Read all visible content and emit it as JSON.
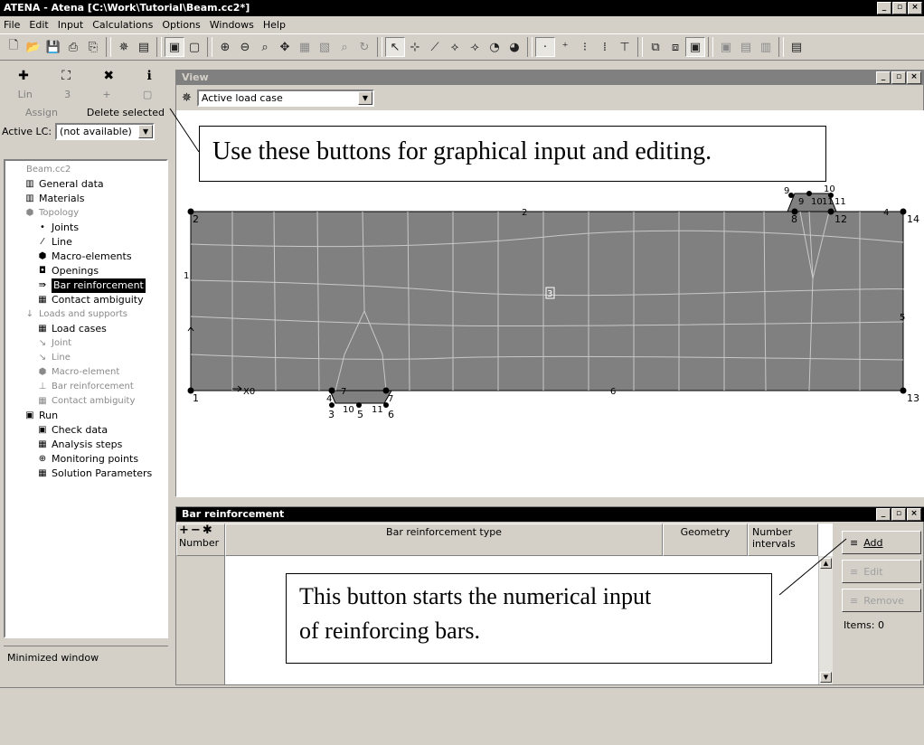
{
  "app": {
    "title": "ATENA - Atena [C:\\Work\\Tutorial\\Beam.cc2*]"
  },
  "menu": [
    "File",
    "Edit",
    "Input",
    "Calculations",
    "Options",
    "Windows",
    "Help"
  ],
  "left_panel": {
    "buttons": [
      "✚",
      "⛶",
      "✖",
      "ℹ"
    ],
    "row2": [
      "Lin",
      "3",
      "+",
      "▢"
    ],
    "assign_label": "Assign",
    "delete_label": "Delete selected",
    "active_lc_label": "Active LC:",
    "active_lc_value": "(not available)",
    "minimized_label": "Minimized window",
    "tree": [
      {
        "label": "Beam.cc2",
        "style": "gray",
        "indent": 0,
        "icon": ""
      },
      {
        "label": "General data",
        "style": "normal",
        "indent": 1,
        "icon": "▥"
      },
      {
        "label": "Materials",
        "style": "normal",
        "indent": 1,
        "icon": "▥"
      },
      {
        "label": "Topology",
        "style": "gray",
        "indent": 1,
        "icon": "⬢"
      },
      {
        "label": "Joints",
        "style": "normal",
        "indent": 2,
        "icon": "•"
      },
      {
        "label": "Line",
        "style": "normal",
        "indent": 2,
        "icon": "⁄"
      },
      {
        "label": "Macro-elements",
        "style": "normal",
        "indent": 2,
        "icon": "⬢"
      },
      {
        "label": "Openings",
        "style": "normal",
        "indent": 2,
        "icon": "◘"
      },
      {
        "label": "Bar reinforcement",
        "style": "selected",
        "indent": 2,
        "icon": "⇛"
      },
      {
        "label": "Contact ambiguity",
        "style": "normal",
        "indent": 2,
        "icon": "▦"
      },
      {
        "label": "Loads and supports",
        "style": "gray",
        "indent": 1,
        "icon": "↓"
      },
      {
        "label": "Load cases",
        "style": "normal",
        "indent": 2,
        "icon": "▦"
      },
      {
        "label": "Joint",
        "style": "gray",
        "indent": 2,
        "icon": "↘"
      },
      {
        "label": "Line",
        "style": "gray",
        "indent": 2,
        "icon": "↘"
      },
      {
        "label": "Macro-element",
        "style": "gray",
        "indent": 2,
        "icon": "⬢"
      },
      {
        "label": "Bar reinforcement",
        "style": "gray",
        "indent": 2,
        "icon": "⊥"
      },
      {
        "label": "Contact ambiguity",
        "style": "gray",
        "indent": 2,
        "icon": "▦"
      },
      {
        "label": "Run",
        "style": "normal",
        "indent": 1,
        "icon": "▣"
      },
      {
        "label": "Check data",
        "style": "normal",
        "indent": 2,
        "icon": "▣"
      },
      {
        "label": "Analysis steps",
        "style": "normal",
        "indent": 2,
        "icon": "▦"
      },
      {
        "label": "Monitoring points",
        "style": "normal",
        "indent": 2,
        "icon": "⊕"
      },
      {
        "label": "Solution Parameters",
        "style": "normal",
        "indent": 2,
        "icon": "▦"
      }
    ]
  },
  "view_window": {
    "title": "View",
    "combo_value": "Active load case",
    "callout": "Use these buttons for graphical input and editing.",
    "labels": {
      "j1": "1",
      "j2": "2",
      "j3": "3",
      "j4": "4",
      "j5": "5",
      "j6": "6",
      "j7": "7",
      "j8": "8",
      "j9": "9",
      "j10": "10",
      "j11": "11",
      "j12": "12",
      "j13": "13",
      "j14": "14",
      "l1": "1",
      "l2": "2",
      "l3": "3",
      "l4": "4",
      "l5": "5",
      "l6": "6",
      "l7": "7",
      "l9": "9",
      "l10": "10",
      "l11": "11",
      "m3": "3",
      "x0": "X0",
      "in_sq": "1"
    }
  },
  "bar_window": {
    "title": "Bar reinforcement",
    "header_icons": [
      "+",
      "−",
      "✱"
    ],
    "col_number": "Number",
    "col_type": "Bar reinforcement type",
    "col_geometry": "Geometry",
    "col_intervals_1": "Number",
    "col_intervals_2": "intervals",
    "add_label": "Add",
    "edit_label": "Edit",
    "remove_label": "Remove",
    "items_label": "Items: 0",
    "callout_line1": "This button starts the numerical input",
    "callout_line2": "of reinforcing bars."
  },
  "colors": {
    "mesh_fill": "#808080",
    "mesh_line": "#c8c8c8",
    "title_active": "#000000",
    "title_inactive": "#808080"
  }
}
